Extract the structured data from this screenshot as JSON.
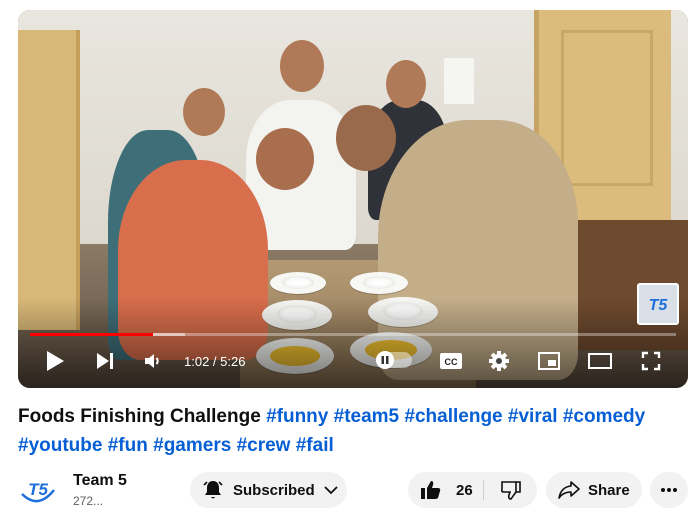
{
  "video": {
    "time_current": "1:02",
    "time_total": "5:26",
    "time_separator": " / ",
    "progress_fraction": 0.19,
    "buffer_fraction": 0.24,
    "watermark": "T5"
  },
  "title": {
    "main": "Foods Finishing Challenge ",
    "hashtags": [
      "#funny",
      "#team5",
      "#challenge",
      "#viral",
      "#comedy",
      "#youtube",
      "#fun",
      "#gamers",
      "#crew",
      "#fail"
    ]
  },
  "channel": {
    "name": "Team 5",
    "subscribers": "272...",
    "avatar_text": "T5"
  },
  "actions": {
    "subscribe_label": "Subscribed",
    "like_count": "26",
    "share_label": "Share"
  },
  "colors": {
    "progress": "#ff0000",
    "hashtag": "#065fd4",
    "pill_bg": "#f2f2f2",
    "brand_blue": "#1e6fd9"
  },
  "icons": [
    "play-icon",
    "next-icon",
    "volume-icon",
    "autoplay-pause-icon",
    "captions-icon",
    "settings-icon",
    "miniplayer-icon",
    "theater-icon",
    "fullscreen-icon",
    "bell-icon",
    "chevron-down-icon",
    "thumbs-up-icon",
    "thumbs-down-icon",
    "share-icon",
    "more-icon"
  ]
}
